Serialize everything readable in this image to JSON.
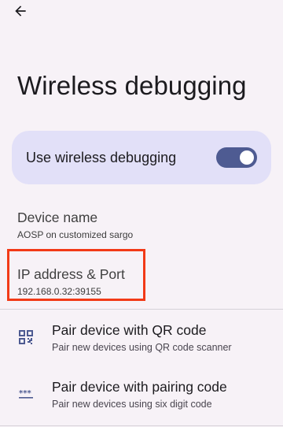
{
  "header": {
    "back_icon": "arrow-back-icon",
    "title": "Wireless debugging"
  },
  "main_switch": {
    "label": "Use wireless debugging",
    "enabled": true,
    "track_color": "#4e5b92",
    "background_color": "#e2e0f8"
  },
  "device_name": {
    "title": "Device name",
    "summary": "AOSP on customized sargo"
  },
  "ip_address": {
    "title": "IP address & Port",
    "summary": "192.168.0.32:39155",
    "highlight_color": "#f23a17"
  },
  "actions": [
    {
      "icon": "qr-code-scanner-icon",
      "title": "Pair device with QR code",
      "summary": "Pair new devices using QR code scanner"
    },
    {
      "icon": "password-dots-icon",
      "title": "Pair device with pairing code",
      "summary": "Pair new devices using six digit code"
    }
  ]
}
